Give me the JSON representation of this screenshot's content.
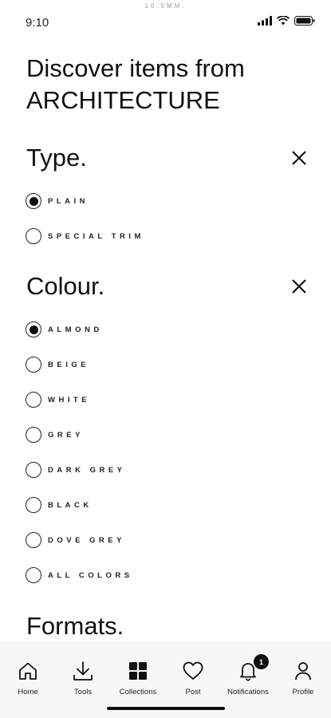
{
  "status_bar": {
    "time": "9:10",
    "caption": "10.5MM."
  },
  "page": {
    "title_line1": "Discover items from",
    "title_line2": "ARCHITECTURE"
  },
  "sections": {
    "type": {
      "title": "Type.",
      "options": [
        {
          "label": "PLAIN",
          "selected": true
        },
        {
          "label": "SPECIAL TRIM",
          "selected": false
        }
      ]
    },
    "colour": {
      "title": "Colour.",
      "options": [
        {
          "label": "ALMOND",
          "selected": true
        },
        {
          "label": "BEIGE",
          "selected": false
        },
        {
          "label": "WHITE",
          "selected": false
        },
        {
          "label": "GREY",
          "selected": false
        },
        {
          "label": "DARK GREY",
          "selected": false
        },
        {
          "label": "BLACK",
          "selected": false
        },
        {
          "label": "DOVE GREY",
          "selected": false
        },
        {
          "label": "ALL COLORS",
          "selected": false
        }
      ]
    },
    "formats": {
      "title": "Formats."
    }
  },
  "tab_bar": {
    "tabs": [
      {
        "label": "Home",
        "icon": "home-icon"
      },
      {
        "label": "Tools",
        "icon": "download-icon"
      },
      {
        "label": "Collections",
        "icon": "grid-icon"
      },
      {
        "label": "Post",
        "icon": "heart-icon"
      },
      {
        "label": "Notifications",
        "icon": "bell-icon",
        "badge": "1"
      },
      {
        "label": "Profile",
        "icon": "user-icon"
      }
    ]
  }
}
